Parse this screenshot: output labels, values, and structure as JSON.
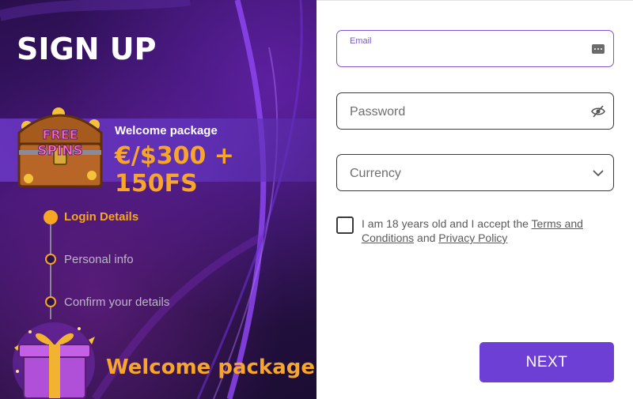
{
  "signup": {
    "title": "SIGN UP",
    "banner": {
      "subtitle": "Welcome package",
      "offer": "€/$300 + 150FS",
      "chest_text_1": "FREE",
      "chest_text_2": "SPINS"
    },
    "steps": [
      {
        "label": "Login Details",
        "active": true
      },
      {
        "label": "Personal info",
        "active": false
      },
      {
        "label": "Confirm your details",
        "active": false
      }
    ],
    "bottom_promo": "Welcome package"
  },
  "form": {
    "email": {
      "label": "Email",
      "value": ""
    },
    "password": {
      "placeholder": "Password"
    },
    "currency": {
      "placeholder": "Currency"
    },
    "terms": {
      "prefix": "I am 18 years old and I accept the ",
      "terms_link": "Terms and Conditions",
      "middle": " and ",
      "privacy_link": "Privacy Policy"
    },
    "next_label": "NEXT"
  },
  "colors": {
    "accent": "#6e3fd4",
    "gold": "#f6a623",
    "panel_dark": "#2a0f4e"
  }
}
